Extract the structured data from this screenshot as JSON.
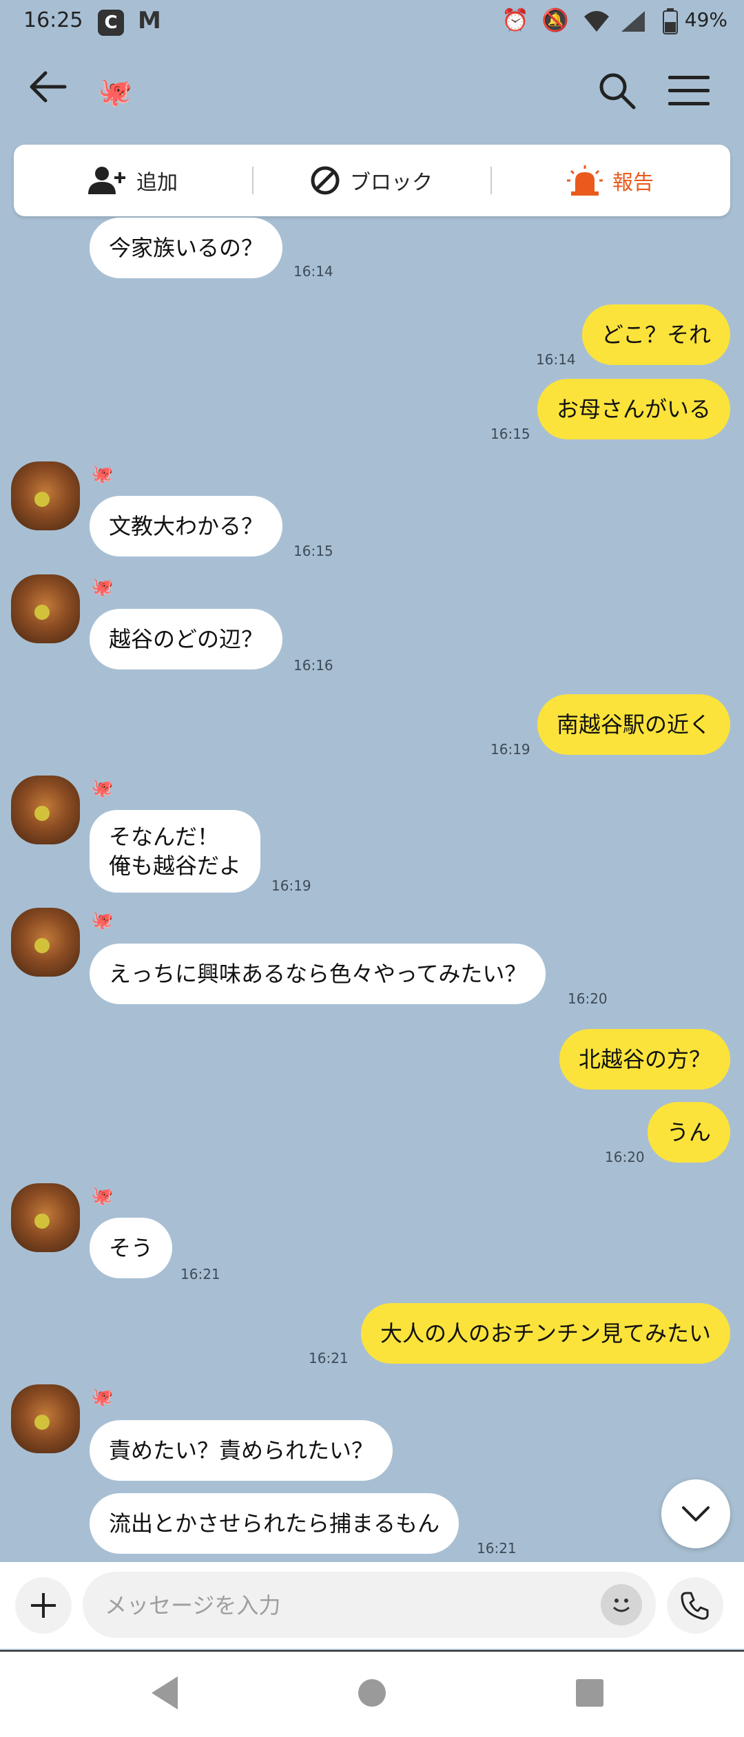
{
  "status_bar": {
    "time": "16:25",
    "app_icons": [
      "C",
      "M"
    ],
    "battery": "49%",
    "icons": [
      "alarm-icon",
      "mute-icon",
      "wifi-icon",
      "signal-icon",
      "battery-icon"
    ]
  },
  "header": {
    "avatar_emoji": "🐙"
  },
  "actions": {
    "add_label": "追加",
    "block_label": "ブロック",
    "report_label": "報告",
    "report_color": "#ea5a1d"
  },
  "sender_emoji": "🐙",
  "messages": [
    {
      "dir": "in",
      "text": "今家族いるの？",
      "time": "16:14"
    },
    {
      "dir": "out",
      "text": "どこ？それ",
      "time": "16:14"
    },
    {
      "dir": "out",
      "text": "お母さんがいる",
      "time": "16:15"
    },
    {
      "dir": "in",
      "text": "文教大わかる？",
      "time": "16:15"
    },
    {
      "dir": "in",
      "text": "越谷のどの辺？",
      "time": "16:16"
    },
    {
      "dir": "out",
      "text": "南越谷駅の近く",
      "time": "16:19"
    },
    {
      "dir": "in",
      "text": "そなんだ！\n俺も越谷だよ",
      "time": "16:19"
    },
    {
      "dir": "in",
      "text": "えっちに興味あるなら色々やってみたい？",
      "time": "16:20"
    },
    {
      "dir": "out",
      "text": "北越谷の方？",
      "time": ""
    },
    {
      "dir": "out",
      "text": "うん",
      "time": "16:20"
    },
    {
      "dir": "in",
      "text": "そう",
      "time": "16:21"
    },
    {
      "dir": "out",
      "text": "大人の人のおチンチン見てみたい",
      "time": "16:21"
    },
    {
      "dir": "in",
      "text": "責めたい？責められたい？",
      "time": ""
    },
    {
      "dir": "in",
      "text": "流出とかさせられたら捕まるもん",
      "time": "16:21"
    }
  ],
  "input": {
    "placeholder": "メッセージを入力"
  },
  "colors": {
    "chat_background": "#a8bfd3",
    "outgoing_bubble": "#fbe33b",
    "incoming_bubble": "#ffffff"
  }
}
